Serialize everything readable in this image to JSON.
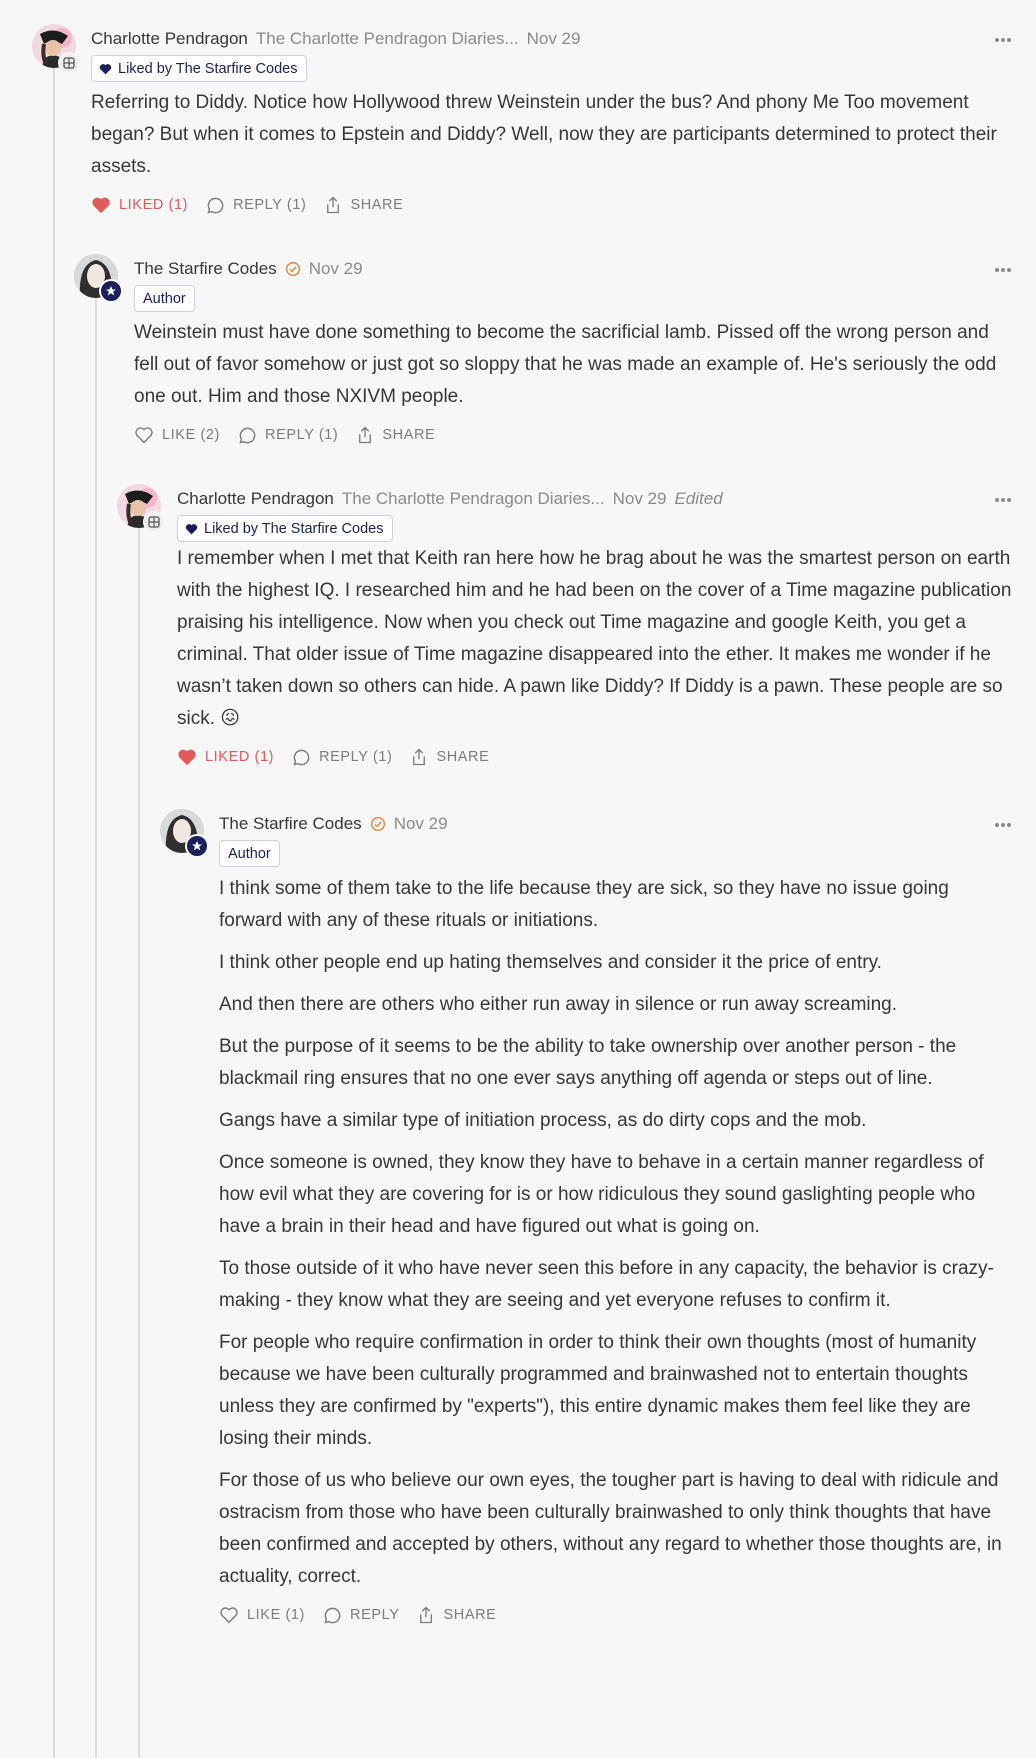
{
  "comments": [
    {
      "author": "Charlotte Pendragon",
      "publication": "The Charlotte Pendragon Diaries...",
      "date": "Nov 29",
      "liked_by": "Liked by The Starfire Codes",
      "paragraphs": [
        "Referring to Diddy. Notice how Hollywood threw Weinstein under the bus? And phony Me Too movement began? But when it comes to Epstein and Diddy? Well, now they are participants determined to protect their assets."
      ],
      "like_label": "LIKED (1)",
      "reply_label": "REPLY (1)",
      "share_label": "SHARE"
    },
    {
      "author": "The Starfire Codes",
      "date": "Nov 29",
      "badge": "Author",
      "paragraphs": [
        "Weinstein must have done something to become the sacrificial lamb. Pissed off the wrong person and fell out of favor somehow or just got so sloppy that he was made an example of. He's seriously the odd one out. Him and those NXIVM people."
      ],
      "like_label": "LIKE (2)",
      "reply_label": "REPLY (1)",
      "share_label": "SHARE"
    },
    {
      "author": "Charlotte Pendragon",
      "publication": "The Charlotte Pendragon Diaries...",
      "date": "Nov 29",
      "edited": "Edited",
      "liked_by": "Liked by The Starfire Codes",
      "paragraphs": [
        "I remember when I met that Keith ran here how he brag about he was the smartest person on earth with the highest IQ. I researched him and he had been on the cover of a Time magazine publication praising his intelligence. Now when you check out Time magazine and google Keith, you get a criminal. That older issue of Time magazine disappeared into the ether. It makes me wonder if he wasn’t taken down so others can hide. A pawn like Diddy? If Diddy is a pawn. These people are so sick. 😖"
      ],
      "like_label": "LIKED (1)",
      "reply_label": "REPLY (1)",
      "share_label": "SHARE"
    },
    {
      "author": "The Starfire Codes",
      "date": "Nov 29",
      "badge": "Author",
      "paragraphs": [
        "I think some of them take to the life because they are sick, so they have no issue going forward with any of these rituals or initiations.",
        "I think other people end up hating themselves and consider it the price of entry.",
        "And then there are others who either run away in silence or run away screaming.",
        "But the purpose of it seems to be the ability to take ownership over another person - the blackmail ring ensures that no one ever says anything off agenda or steps out of line.",
        "Gangs have a similar type of initiation process, as do dirty cops and the mob.",
        "Once someone is owned, they know they have to behave in a certain manner regardless of how evil what they are covering for is or how ridiculous they sound gaslighting people who have a brain in their head and have figured out what is going on.",
        "To those outside of it who have never seen this before in any capacity, the behavior is crazy-making - they know what they are seeing and yet everyone refuses to confirm it.",
        "For people who require confirmation in order to think their own thoughts (most of humanity because we have been culturally programmed and brainwashed not to entertain thoughts unless they are confirmed by \"experts\"), this entire dynamic makes them feel like they are losing their minds.",
        "For those of us who believe our own eyes, the tougher part is having to deal with ridicule and ostracism from those who have been culturally brainwashed to only think thoughts that have been confirmed and accepted by others, without any regard to whether those thoughts are, in actuality, correct."
      ],
      "like_label": "LIKE (1)",
      "reply_label": "REPLY",
      "share_label": "SHARE"
    }
  ],
  "colors": {
    "liked": "#e05a5a",
    "verified": "#e8823a",
    "navy": "#1b1f5a",
    "muted": "#8a8a8a"
  }
}
